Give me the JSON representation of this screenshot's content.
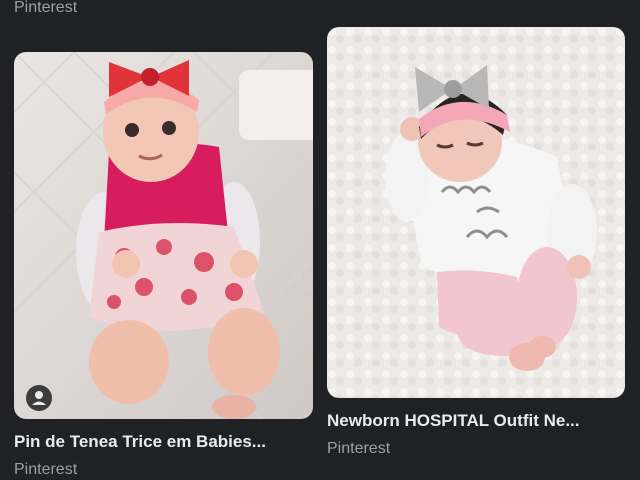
{
  "top_result": {
    "source": "Pinterest"
  },
  "results": [
    {
      "title": "Pin de Tenea Trice em Babies...",
      "source": "Pinterest",
      "image_icon": "baby-photo"
    },
    {
      "title": "Newborn HOSPITAL Outfit Ne...",
      "source": "Pinterest",
      "image_icon": "baby-photo"
    }
  ],
  "badge_icon": "person-icon",
  "colors": {
    "background": "#202124",
    "title": "#e8eaed",
    "source": "#9aa0a6"
  }
}
